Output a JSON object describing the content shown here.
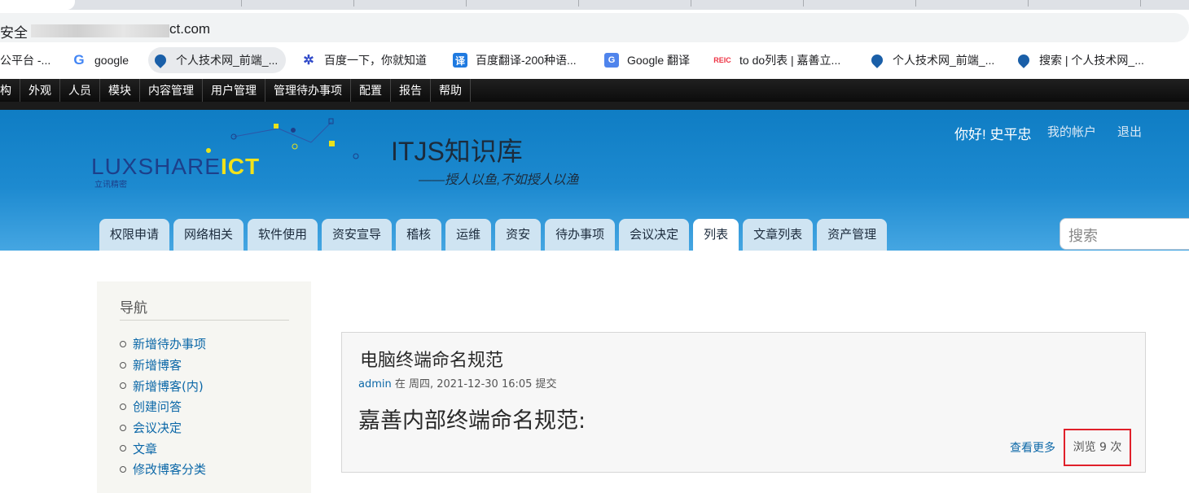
{
  "browser": {
    "address_secure_label": "安全",
    "address_url_visible": "ct.com",
    "bookmarks": [
      {
        "label": "公平台 -...",
        "icon": "none"
      },
      {
        "label": "google",
        "icon": "google-g-icon"
      },
      {
        "label": "个人技术网_前端_...",
        "icon": "drupal-drop-icon"
      },
      {
        "label": "百度一下，你就知道",
        "icon": "baidu-paw-icon"
      },
      {
        "label": "百度翻译-200种语...",
        "icon": "baidu-translate-icon"
      },
      {
        "label": "Google 翻译",
        "icon": "google-translate-icon"
      },
      {
        "label": "to do列表 | 嘉善立...",
        "icon": "reic-icon"
      },
      {
        "label": "个人技术网_前端_...",
        "icon": "drupal-drop-icon"
      },
      {
        "label": "搜索 | 个人技术网_...",
        "icon": "drupal-drop-icon"
      }
    ]
  },
  "admin_menu": [
    "构",
    "外观",
    "人员",
    "模块",
    "内容管理",
    "用户管理",
    "管理待办事项",
    "配置",
    "报告",
    "帮助"
  ],
  "header": {
    "logo_text_main": "LUXSHARE",
    "logo_text_accent": "ICT",
    "logo_subtitle": "立讯精密",
    "site_name": "ITJS知识库",
    "slogan": "——授人以鱼,不如授人以渔",
    "greeting": "你好! 史平忠",
    "my_account": "我的帐户",
    "logout": "退出",
    "search_placeholder": "搜索",
    "colors": {
      "header_blue": "#1d8ad0",
      "tab_bg": "#cfe4f2",
      "active_tab": "#ffffff"
    }
  },
  "main_tabs": [
    {
      "label": "权限申请",
      "active": false
    },
    {
      "label": "网络相关",
      "active": false
    },
    {
      "label": "软件使用",
      "active": false
    },
    {
      "label": "资安宣导",
      "active": false
    },
    {
      "label": "稽核",
      "active": false
    },
    {
      "label": "运维",
      "active": false
    },
    {
      "label": "资安",
      "active": false
    },
    {
      "label": "待办事项",
      "active": false
    },
    {
      "label": "会议决定",
      "active": false
    },
    {
      "label": "列表",
      "active": true
    },
    {
      "label": "文章列表",
      "active": false
    },
    {
      "label": "资产管理",
      "active": false
    }
  ],
  "sidebar": {
    "title": "导航",
    "items": [
      "新增待办事项",
      "新增博客",
      "新增博客(内)",
      "创建问答",
      "会议决定",
      "文章",
      "修改博客分类"
    ]
  },
  "node": {
    "title": "电脑终端命名规范",
    "author": "admin",
    "meta_text": " 在 周四, 2021-12-30 16:05 提交",
    "body": "嘉善内部终端命名规范:",
    "read_more": "查看更多",
    "view_count": "浏览 9 次",
    "highlight_color": "#e0202a"
  }
}
